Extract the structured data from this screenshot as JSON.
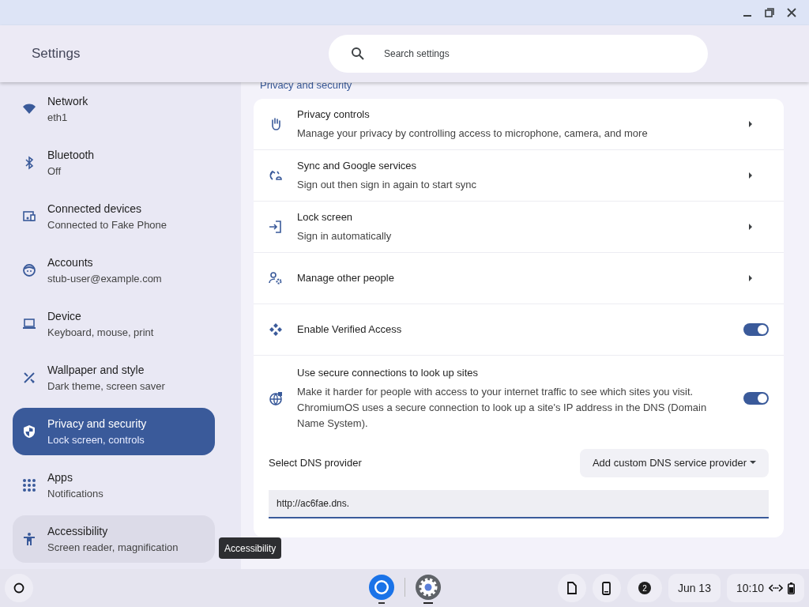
{
  "window": {
    "title": "Settings"
  },
  "search": {
    "placeholder": "Search settings"
  },
  "sidebar": {
    "items": [
      {
        "label": "Network",
        "sublabel": "eth1",
        "selected": false,
        "hovered": false
      },
      {
        "label": "Bluetooth",
        "sublabel": "Off",
        "selected": false,
        "hovered": false
      },
      {
        "label": "Connected devices",
        "sublabel": "Connected to Fake Phone",
        "selected": false,
        "hovered": false
      },
      {
        "label": "Accounts",
        "sublabel": "stub-user@example.com",
        "selected": false,
        "hovered": false
      },
      {
        "label": "Device",
        "sublabel": "Keyboard, mouse, print",
        "selected": false,
        "hovered": false
      },
      {
        "label": "Wallpaper and style",
        "sublabel": "Dark theme, screen saver",
        "selected": false,
        "hovered": false
      },
      {
        "label": "Privacy and security",
        "sublabel": "Lock screen, controls",
        "selected": true,
        "hovered": false
      },
      {
        "label": "Apps",
        "sublabel": "Notifications",
        "selected": false,
        "hovered": false
      },
      {
        "label": "Accessibility",
        "sublabel": "Screen reader, magnification",
        "selected": false,
        "hovered": true
      }
    ]
  },
  "tooltip": "Accessibility",
  "section": {
    "title": "Privacy and security",
    "rows": [
      {
        "kind": "link",
        "title": "Privacy controls",
        "description": "Manage your privacy by controlling access to microphone, camera, and more"
      },
      {
        "kind": "link",
        "title": "Sync and Google services",
        "description": "Sign out then sign in again to start sync"
      },
      {
        "kind": "link",
        "title": "Lock screen",
        "description": "Sign in automatically"
      },
      {
        "kind": "link",
        "title": "Manage other people"
      },
      {
        "kind": "toggle",
        "title": "Enable Verified Access",
        "on": true
      },
      {
        "kind": "toggle",
        "title": "Use secure connections to look up sites",
        "description": "Make it harder for people with access to your internet traffic to see which sites you visit. ChromiumOS uses a secure connection to look up a site's IP address in the DNS (Domain Name System).",
        "on": true
      }
    ],
    "dns": {
      "label": "Select DNS provider",
      "dropdown": "Add custom DNS service provider",
      "value": "http://ac6fae.dns."
    }
  },
  "taskbar": {
    "notification_count": "2",
    "date": "Jun 13",
    "time": "10:10"
  }
}
